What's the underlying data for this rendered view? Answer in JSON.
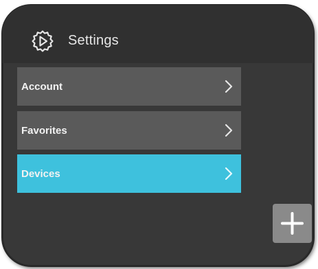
{
  "header": {
    "title": "Settings",
    "icon": "gear-icon"
  },
  "menu": {
    "items": [
      {
        "label": "Account",
        "icon": "chevron-right-icon",
        "active": false
      },
      {
        "label": "Favorites",
        "icon": "chevron-right-icon",
        "active": false
      },
      {
        "label": "Devices",
        "icon": "chevron-right-icon",
        "active": true
      }
    ]
  },
  "add_button": {
    "icon": "plus-icon"
  },
  "colors": {
    "background": "#383838",
    "header": "#303030",
    "menu_item": "#5a5a5a",
    "accent": "#3ec1dd",
    "add_button": "#8a8a8a"
  }
}
